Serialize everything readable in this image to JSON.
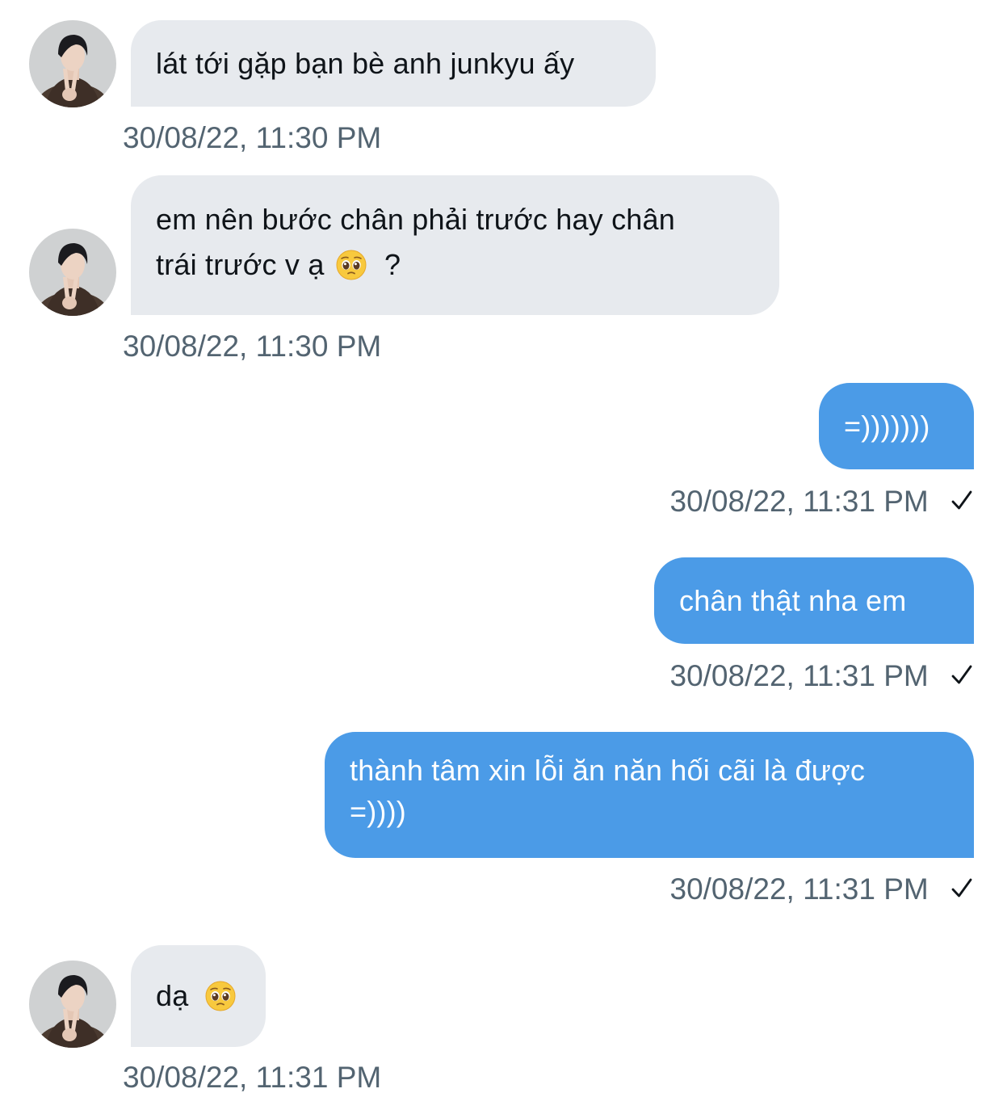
{
  "conversation": {
    "messages": [
      {
        "direction": "incoming",
        "text": "lát tới gặp bạn bè anh junkyu ấy",
        "timestamp": "30/08/22, 11:30 PM"
      },
      {
        "direction": "incoming",
        "line1": "em nên bước chân phải trước hay chân",
        "line2_text": "trái trước v ạ",
        "line2_suffix": "?",
        "emoji": "pleading-face-emoji",
        "timestamp": "30/08/22, 11:30 PM"
      },
      {
        "direction": "outgoing",
        "text": "=)))))))",
        "timestamp": "30/08/22, 11:31 PM",
        "status": "sent-check-icon"
      },
      {
        "direction": "outgoing",
        "text": "chân thật nha em",
        "timestamp": "30/08/22, 11:31 PM",
        "status": "sent-check-icon"
      },
      {
        "direction": "outgoing",
        "line1": "thành tâm xin lỗi ăn năn hối cãi là được",
        "line2": "=))))",
        "timestamp": "30/08/22, 11:31 PM",
        "status": "sent-check-icon"
      },
      {
        "direction": "incoming",
        "text": "dạ",
        "emoji": "pleading-face-emoji",
        "timestamp": "30/08/22, 11:31 PM"
      }
    ]
  },
  "colors": {
    "incoming_bubble": "#e7eaee",
    "outgoing_bubble": "#4b9be7",
    "timestamp_text": "#536471",
    "incoming_text": "#0f1419",
    "outgoing_text": "#ffffff"
  }
}
